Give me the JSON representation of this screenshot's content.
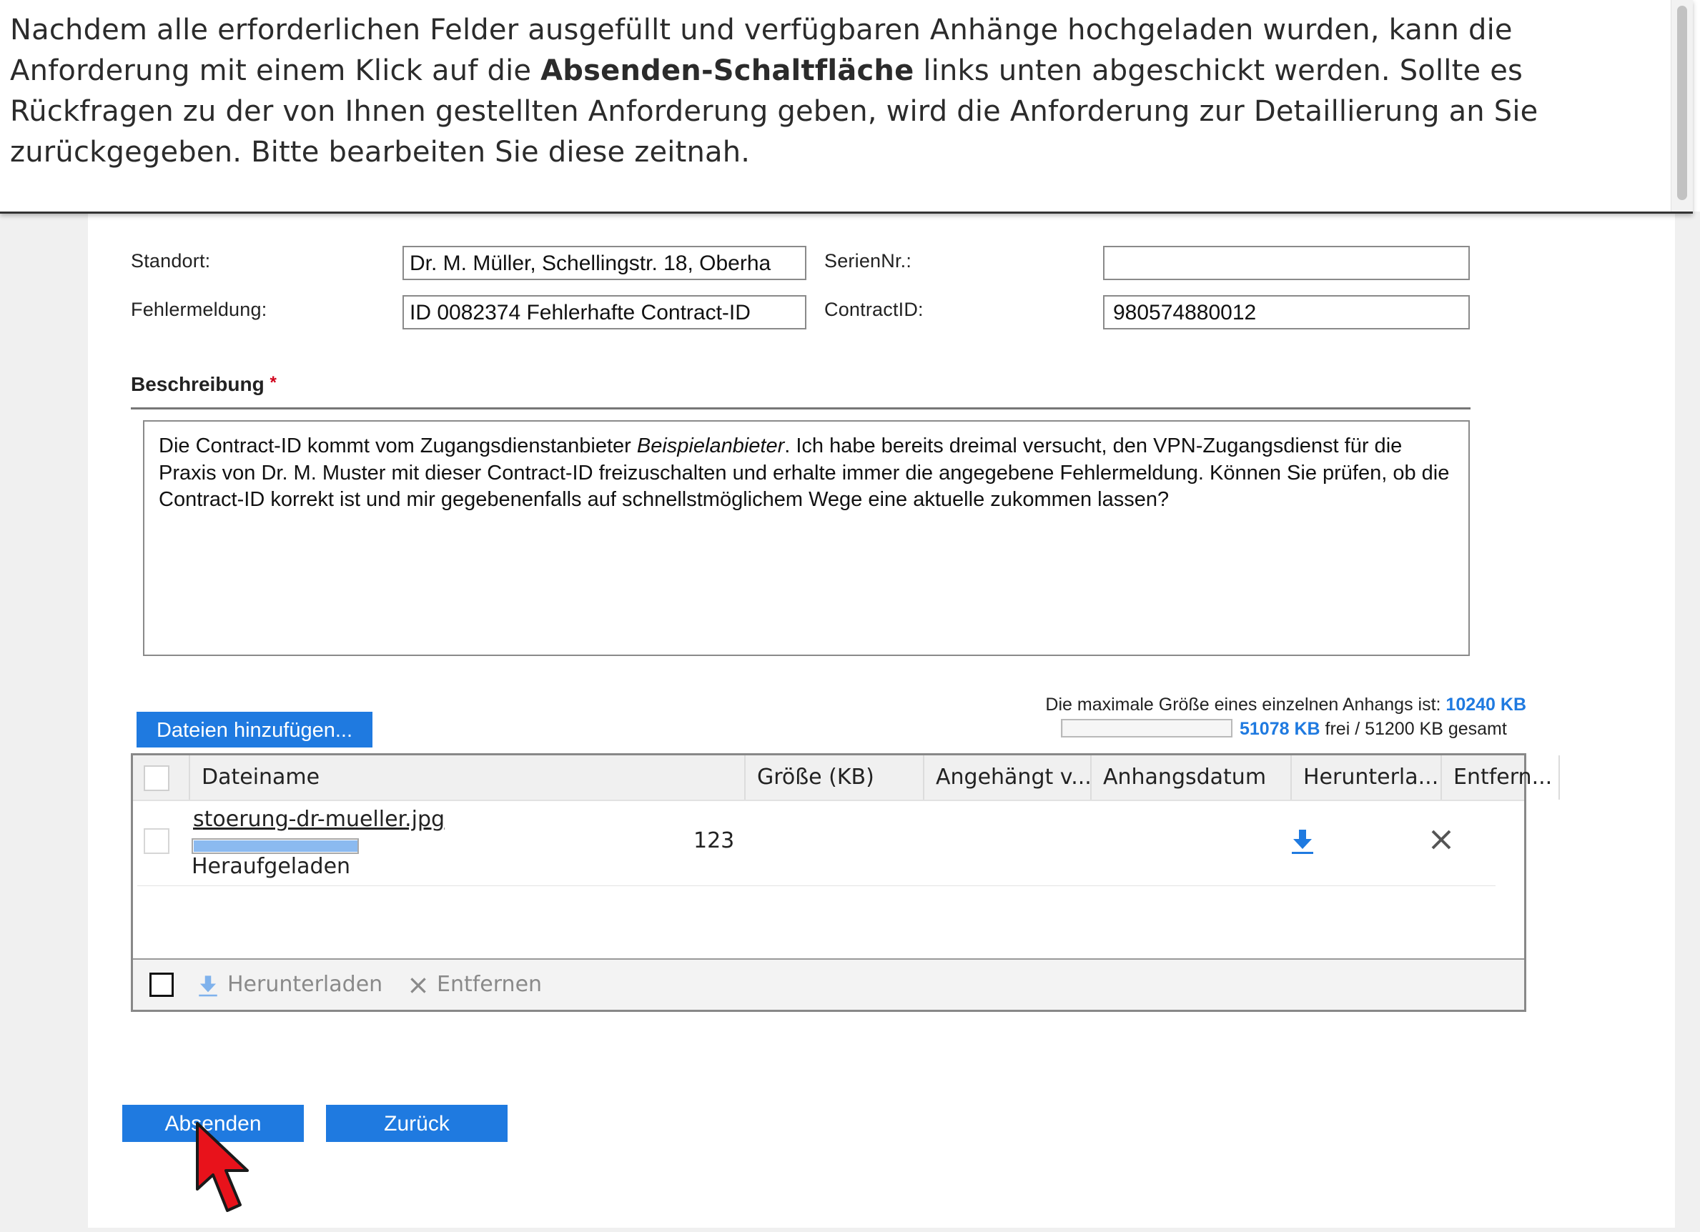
{
  "instruction": {
    "part1": "Nachdem alle erforderlichen Felder ausgefüllt und verfügbaren Anhänge hochgeladen wurden, kann die Anforderung mit einem Klick auf die ",
    "emphasis": "Absenden-Schaltfläche",
    "part2": " links unten abgeschickt werden. Sollte es Rückfragen zu der von Ihnen gestellten Anforderung geben, wird die Anforderung zur Detaillierung an Sie zurückgegeben. Bitte bearbeiten Sie diese zeitnah."
  },
  "fields": {
    "standort_label": "Standort:",
    "standort_value": "Dr. M. Müller, Schellingstr. 18,  Oberha",
    "seriennr_label": "SerienNr.:",
    "seriennr_value": "",
    "fehlermeldung_label": "Fehlermeldung:",
    "fehlermeldung_value": "ID 0082374 Fehlerhafte Contract-ID",
    "contractid_label": "ContractID:",
    "contractid_value": "980574880012"
  },
  "beschreibung": {
    "title": "Beschreibung",
    "required_marker": "*",
    "text_part1": "Die Contract-ID kommt vom Zugangsdienstanbieter ",
    "text_italic": "Beispielanbieter",
    "text_part2": ". Ich habe bereits dreimal versucht, den VPN-Zugangsdienst für die Praxis von Dr. M. Muster mit dieser Contract-ID freizuschalten und erhalte immer die angegebene Fehlermeldung. Können Sie prüfen, ob die Contract-ID korrekt ist und mir gegebenenfalls auf schnellstmöglichem Wege eine aktuelle zukommen lassen?"
  },
  "attachments": {
    "add_button": "Dateien hinzufügen...",
    "max_size_label": "Die maximale Größe eines einzelnen Anhangs ist: ",
    "max_size_value": "10240 KB",
    "free_value": "51078 KB",
    "free_suffix": " frei / 51200 KB gesamt",
    "quota_used_fraction": 0.0024,
    "columns": [
      "Dateiname",
      "Größe (KB)",
      "Angehängt v...",
      "Anhangsdatum",
      "Herunterla...",
      "Entfern..."
    ],
    "files": [
      {
        "name": "stoerung-dr-mueller.jpg",
        "status": "Heraufgeladen",
        "progress": 1.0,
        "size": "123",
        "attached_by": "",
        "date": ""
      }
    ],
    "footer_download": "Herunterladen",
    "footer_remove": "Entfernen"
  },
  "actions": {
    "submit": "Absenden",
    "back": "Zurück"
  },
  "colors": {
    "accent": "#1f7ae0",
    "required": "#d0021b",
    "cursor": "#e8121b"
  },
  "icons": {
    "download": "download-arrow-icon",
    "remove": "close-x-icon",
    "pointer": "mouse-pointer-icon"
  }
}
